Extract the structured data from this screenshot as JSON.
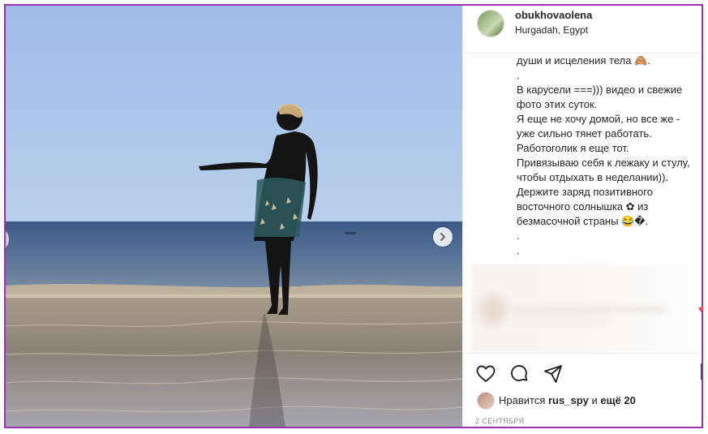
{
  "post": {
    "username": "obukhovaolena",
    "location": "Hurgadah, Egypt",
    "caption_lines": [
      "души и исцеления тела 🙈.",
      ".",
      "В карусели ===))) видео и свежие",
      "фото этих суток.",
      "Я еще не хочу домой, но все же -",
      "уже сильно тянет работать.",
      "Работоголик я еще тот.",
      "Привязываю себя к лежаку и стулу,",
      "чтобы отдыхать в неделании)).",
      "Держите заряд позитивного",
      "восточного солнышка ✿ из",
      "безмасочной страны 😂�.",
      ".",
      "."
    ],
    "likes": {
      "prefix": "Нравится",
      "user": "rus_spy",
      "connector": "и",
      "rest": "ещё 20"
    },
    "date": "2 СЕНТЯБРЯ"
  },
  "icons": {
    "like": "heart-outline-icon",
    "comment": "comment-bubble-icon",
    "share": "paper-plane-icon",
    "next": "chevron-right-icon"
  },
  "colors": {
    "frame_border": "#9b2fb5",
    "text": "#262626",
    "muted": "#8e8e8e",
    "sky": "#a9c6ec"
  }
}
